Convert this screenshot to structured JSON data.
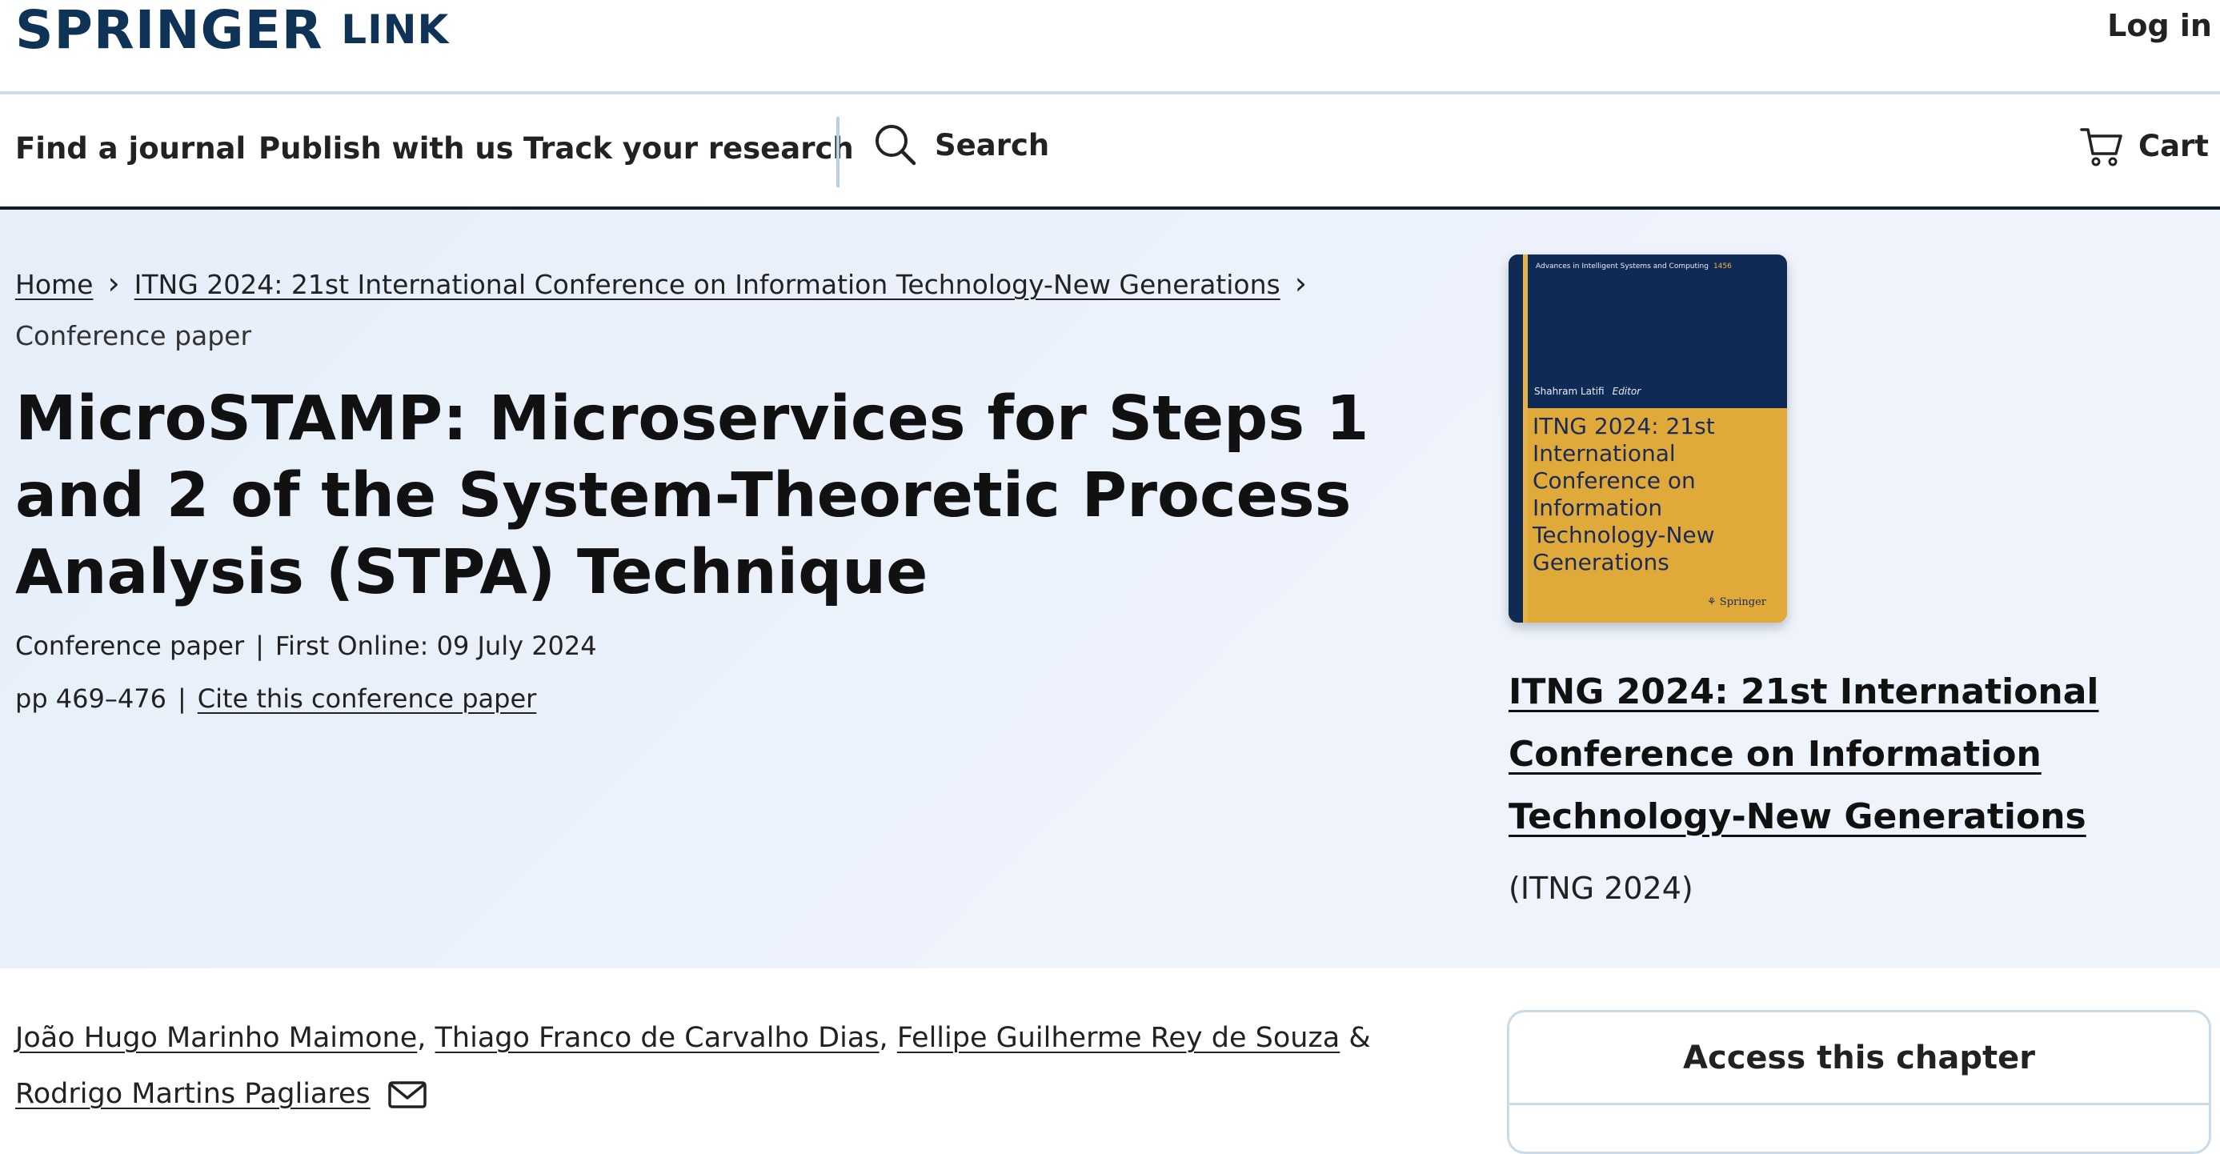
{
  "header": {
    "brand_part1": "SPRINGER",
    "brand_part2": "LINK",
    "login_label": "Log in"
  },
  "nav": {
    "items": [
      "Find a journal",
      "Publish with us",
      "Track your research"
    ],
    "search_label": "Search",
    "cart_label": "Cart",
    "icons": {
      "search": "search-icon",
      "cart": "cart-icon"
    }
  },
  "breadcrumb": {
    "home": "Home",
    "conference": "ITNG 2024: 21st International Conference on Information Technology-New Generations",
    "current": "Conference paper"
  },
  "paper": {
    "title": "MicroSTAMP: Microservices for Steps 1 and 2 of the System-Theoretic Process Analysis (STPA) Technique",
    "type": "Conference paper",
    "first_online": "First Online: 09 July 2024",
    "pages": "pp 469–476",
    "cite_link": "Cite this conference paper"
  },
  "book": {
    "cover_series": "Advances in Intelligent Systems and Computing",
    "cover_series_number": "1456",
    "cover_editor": "Shahram Latifi",
    "cover_editor_role": "Editor",
    "cover_title": "ITNG 2024: 21st International Conference on Information Technology-New Generations",
    "cover_publisher": "Springer",
    "title": "ITNG 2024: 21st International Conference on Information Technology-New Generations",
    "abbreviation": "(ITNG 2024)"
  },
  "authors": {
    "list": [
      "João Hugo Marinho Maimone",
      "Thiago Franco de Carvalho Dias",
      "Fellipe Guilherme Rey de Souza",
      "Rodrigo Martins Pagliares"
    ],
    "separator": ",",
    "conjunction": "&"
  },
  "access": {
    "title": "Access this chapter"
  },
  "colors": {
    "brand": "#0f3357",
    "hero_bg": "#eef3fc",
    "cover_navy": "#0f2a55",
    "cover_gold": "#e0aa3a"
  }
}
